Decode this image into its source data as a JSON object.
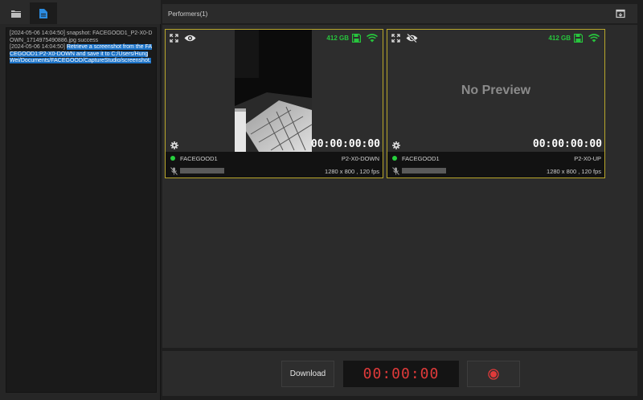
{
  "log": {
    "entries": [
      {
        "text": "[2024-05-06 14:04:50] snapshot: FACEGOOD1_P2-X0-DOWN_1714975490886.jpg success",
        "prefix": "",
        "highlight": ""
      },
      {
        "text": "",
        "prefix": "[2024-05-06 14:04:50] ",
        "highlight": "Retrieve a screenshot from the FACEGOOD1:P2-X0-DOWN and save it to C:/Users/HungWei/Documents/FACEGOOD/CaptureStudio/screenshot."
      }
    ]
  },
  "performers": {
    "title": "Performers(1)",
    "cards": [
      {
        "storage": "412 GB",
        "timecode": "00:00:00:00",
        "performer": "FACEGOOD1",
        "camera": "P2-X0-DOWN",
        "resolution": "1280 x 800 , 120 fps",
        "preview_text": "",
        "visibility_icon": "eye-icon"
      },
      {
        "storage": "412 GB",
        "timecode": "00:00:00:00",
        "performer": "FACEGOOD1",
        "camera": "P2-X0-UP",
        "resolution": "1280 x 800 , 120 fps",
        "preview_text": "No Preview",
        "visibility_icon": "eye-slash-icon"
      }
    ]
  },
  "controls": {
    "download_label": "Download",
    "timer": "00:00:00",
    "record_icon": "record-icon"
  },
  "colors": {
    "accent_green": "#27c53d",
    "card_border": "#b9a72b",
    "timer_red": "#e03a3a",
    "highlight_blue": "#1e74c8"
  }
}
